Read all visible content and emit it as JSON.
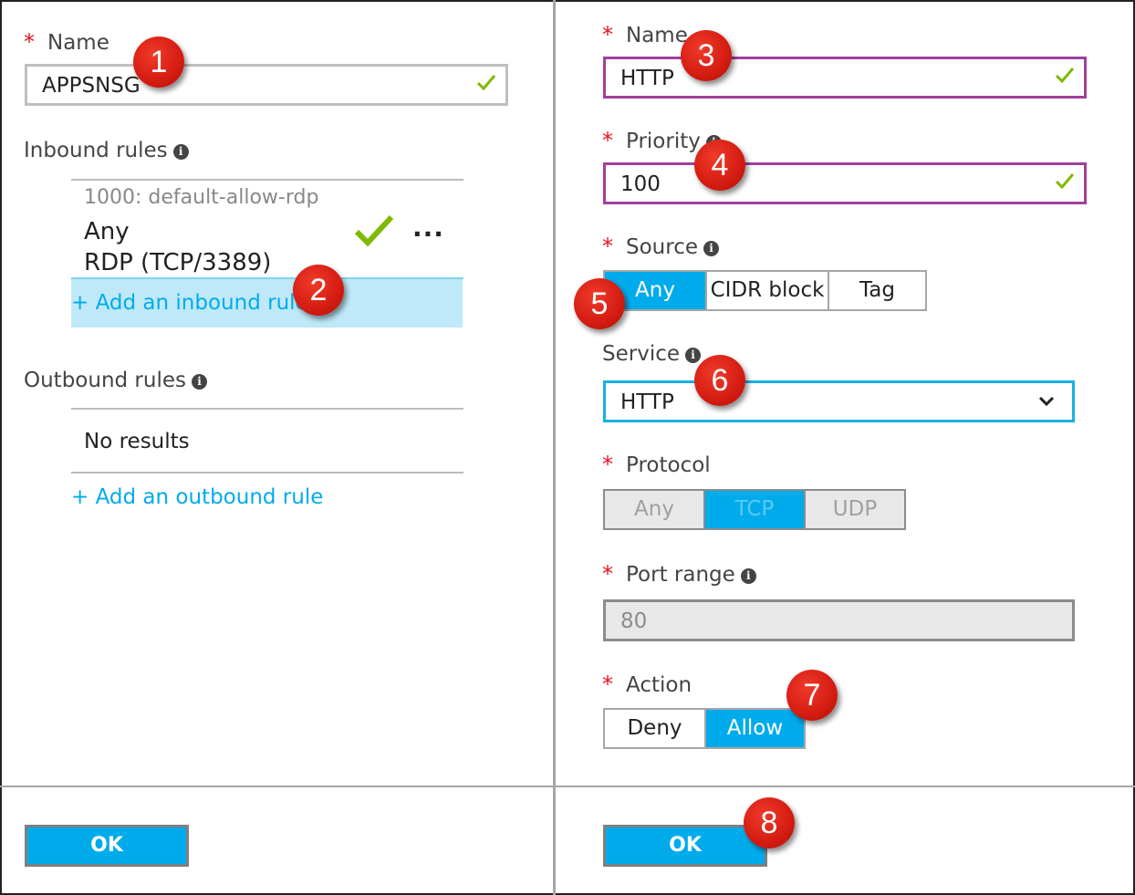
{
  "left": {
    "name_label": "Name",
    "name_value": "APPSNSG",
    "inbound_label": "Inbound rules",
    "inbound_rule": {
      "header": "1000: default-allow-rdp",
      "source": "Any",
      "service": "RDP (TCP/3389)",
      "more": "···"
    },
    "add_inbound": "+ Add an inbound rule",
    "outbound_label": "Outbound rules",
    "no_results": "No results",
    "add_outbound": "+ Add an outbound rule",
    "ok": "OK"
  },
  "right": {
    "name_label": "Name",
    "name_value": "HTTP",
    "priority_label": "Priority",
    "priority_value": "100",
    "source_label": "Source",
    "source_options": [
      "Any",
      "CIDR block",
      "Tag"
    ],
    "source_selected": "Any",
    "service_label": "Service",
    "service_value": "HTTP",
    "protocol_label": "Protocol",
    "protocol_options": [
      "Any",
      "TCP",
      "UDP"
    ],
    "protocol_selected": "TCP",
    "port_label": "Port range",
    "port_value": "80",
    "action_label": "Action",
    "action_options": [
      "Deny",
      "Allow"
    ],
    "action_selected": "Allow",
    "ok": "OK"
  },
  "badges": [
    "1",
    "2",
    "3",
    "4",
    "5",
    "6",
    "7",
    "8"
  ],
  "colors": {
    "accent": "#00abec",
    "required": "#e81123",
    "valid": "#7fba00",
    "badge": "#d41c12",
    "focus_purple": "#a0409d"
  }
}
